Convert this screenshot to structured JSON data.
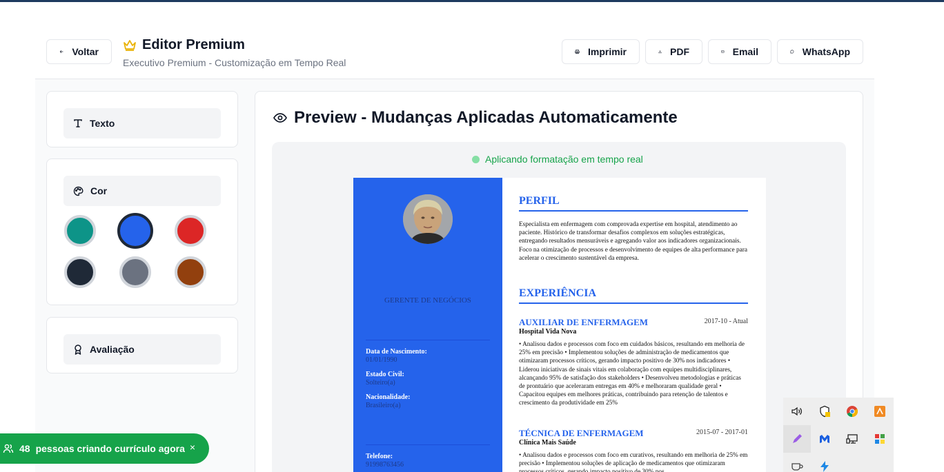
{
  "header": {
    "back_label": "Voltar",
    "title": "Editor Premium",
    "subtitle": "Executivo Premium - Customização em Tempo Real",
    "actions": {
      "print": "Imprimir",
      "pdf": "PDF",
      "email": "Email",
      "whatsapp": "WhatsApp"
    }
  },
  "sidebar": {
    "text_label": "Texto",
    "color_label": "Cor",
    "rating_label": "Avaliação",
    "colors": [
      "#0d9488",
      "#2563eb",
      "#dc2626",
      "#1f2937",
      "#6b7280",
      "#92400e"
    ],
    "selected_color": "#2563eb"
  },
  "preview": {
    "title": "Preview - Mudanças Aplicadas Automaticamente",
    "status": "Aplicando formatação em tempo real"
  },
  "resume": {
    "role": "GERENTE DE NEGÓCIOS",
    "details": [
      {
        "label": "Data de Nascimento:",
        "value": "01/01/1990"
      },
      {
        "label": "Estado Civil:",
        "value": "Solteiro(a)"
      },
      {
        "label": "Nacionalidade:",
        "value": "Brasileiro(a)"
      }
    ],
    "phone_label": "Telefone:",
    "phone": "91998763456",
    "profile_heading": "PERFIL",
    "profile_text": "Especialista em enfermagem com comprovada expertise em hospital, atendimento ao paciente. Histórico de transformar desafios complexos em soluções estratégicas, entregando resultados mensuráveis e agregando valor aos indicadores organizacionais. Foco na otimização de processos e desenvolvimento de equipes de alta performance para acelerar o crescimento sustentável da empresa.",
    "experience_heading": "EXPERIÊNCIA",
    "jobs": [
      {
        "title": "AUXILIAR DE ENFERMAGEM",
        "date": "2017-10 - Atual",
        "company": "Hospital Vida Nova",
        "description": "• Analisou dados e processos com foco em cuidados básicos, resultando em melhoria de 25% em precisão • Implementou soluções de administração de medicamentos que otimizaram processos críticos, gerando impacto positivo de 30% nos indicadores • Liderou iniciativas de sinais vitais em colaboração com equipes multidisciplinares, alcançando 95% de satisfação dos stakeholders • Desenvolveu metodologias e práticas de prontuário que aceleraram entregas em 40% e melhoraram qualidade geral • Capacitou equipes em melhores práticas, contribuindo para retenção de talentos e crescimento da produtividade em 25%"
      },
      {
        "title": "TÉCNICA DE ENFERMAGEM",
        "date": "2015-07 - 2017-01",
        "company": "Clínica Mais Saúde",
        "description": "• Analisou dados e processos com foco em curativos, resultando em melhoria de 25% em precisão • Implementou soluções de aplicação de medicamentos que otimizaram processos críticos, gerando impacto positivo de 30% nos"
      }
    ]
  },
  "toast": {
    "count": "48",
    "message": "pessoas criando currículo agora",
    "close": "×"
  },
  "tray": {
    "icons": [
      "speaker-icon",
      "security-shield-icon",
      "chrome-icon",
      "app-icon",
      "pen-icon",
      "malwarebytes-icon",
      "network-monitor-icon",
      "color-grid-icon",
      "cup-icon",
      "bolt-icon"
    ]
  }
}
